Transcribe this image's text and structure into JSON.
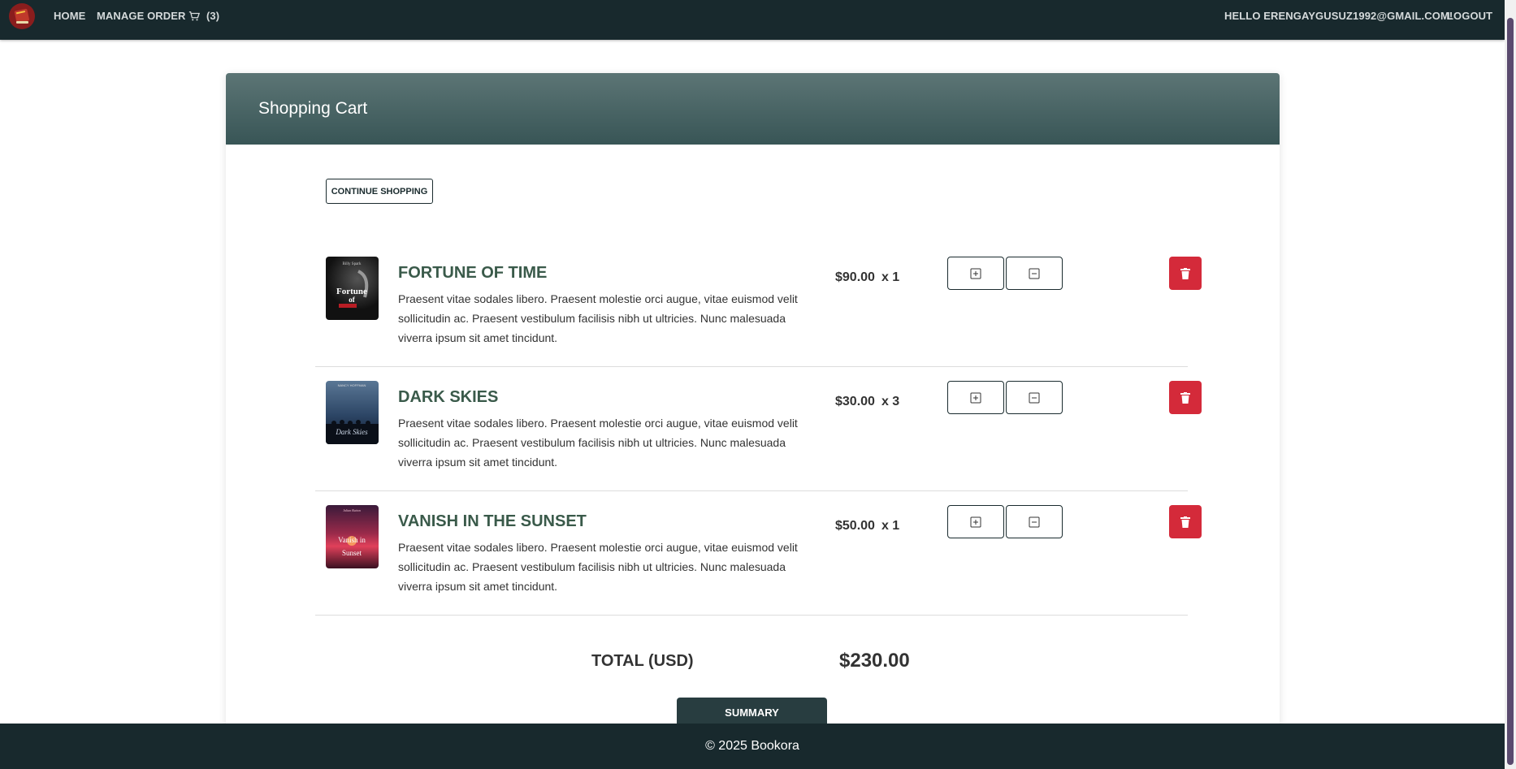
{
  "nav": {
    "home": "HOME",
    "manage_order": "MANAGE ORDER",
    "cart_count": "(3)",
    "hello": "HELLO ERENGAYGUSUZ1992@GMAIL.COM!",
    "logout": "LOGOUT"
  },
  "cart": {
    "title": "Shopping Cart",
    "continue_label": "CONTINUE SHOPPING",
    "items": [
      {
        "title": "FORTUNE OF TIME",
        "description": "Praesent vitae sodales libero. Praesent molestie orci augue, vitae euismod velit sollicitudin ac. Praesent vestibulum facilisis nibh ut ultricies. Nunc malesuada viverra ipsum sit amet tincidunt.",
        "price": "$90.00",
        "qty": "x 1",
        "cover_author": "Billy Spark",
        "cover_title": "Fortune of Time"
      },
      {
        "title": "DARK SKIES",
        "description": "Praesent vitae sodales libero. Praesent molestie orci augue, vitae euismod velit sollicitudin ac. Praesent vestibulum facilisis nibh ut ultricies. Nunc malesuada viverra ipsum sit amet tincidunt.",
        "price": "$30.00",
        "qty": "x 3",
        "cover_author": "NANCY HOFFMAN",
        "cover_title": "Dark Skies"
      },
      {
        "title": "VANISH IN THE SUNSET",
        "description": "Praesent vitae sodales libero. Praesent molestie orci augue, vitae euismod velit sollicitudin ac. Praesent vestibulum facilisis nibh ut ultricies. Nunc malesuada viverra ipsum sit amet tincidunt.",
        "price": "$50.00",
        "qty": "x 1",
        "cover_author": "Julian Button",
        "cover_title": "Vanish in Sunset"
      }
    ],
    "total_label": "TOTAL (USD)",
    "total_value": "$230.00",
    "summary_label": "SUMMARY"
  },
  "footer": {
    "text": "© 2025 Bookora"
  },
  "colors": {
    "navbar": "#18292d",
    "header_gradient_top": "#5c7575",
    "header_gradient_bottom": "#385556",
    "item_title": "#3a5a4a",
    "delete_button": "#d42a3a"
  }
}
